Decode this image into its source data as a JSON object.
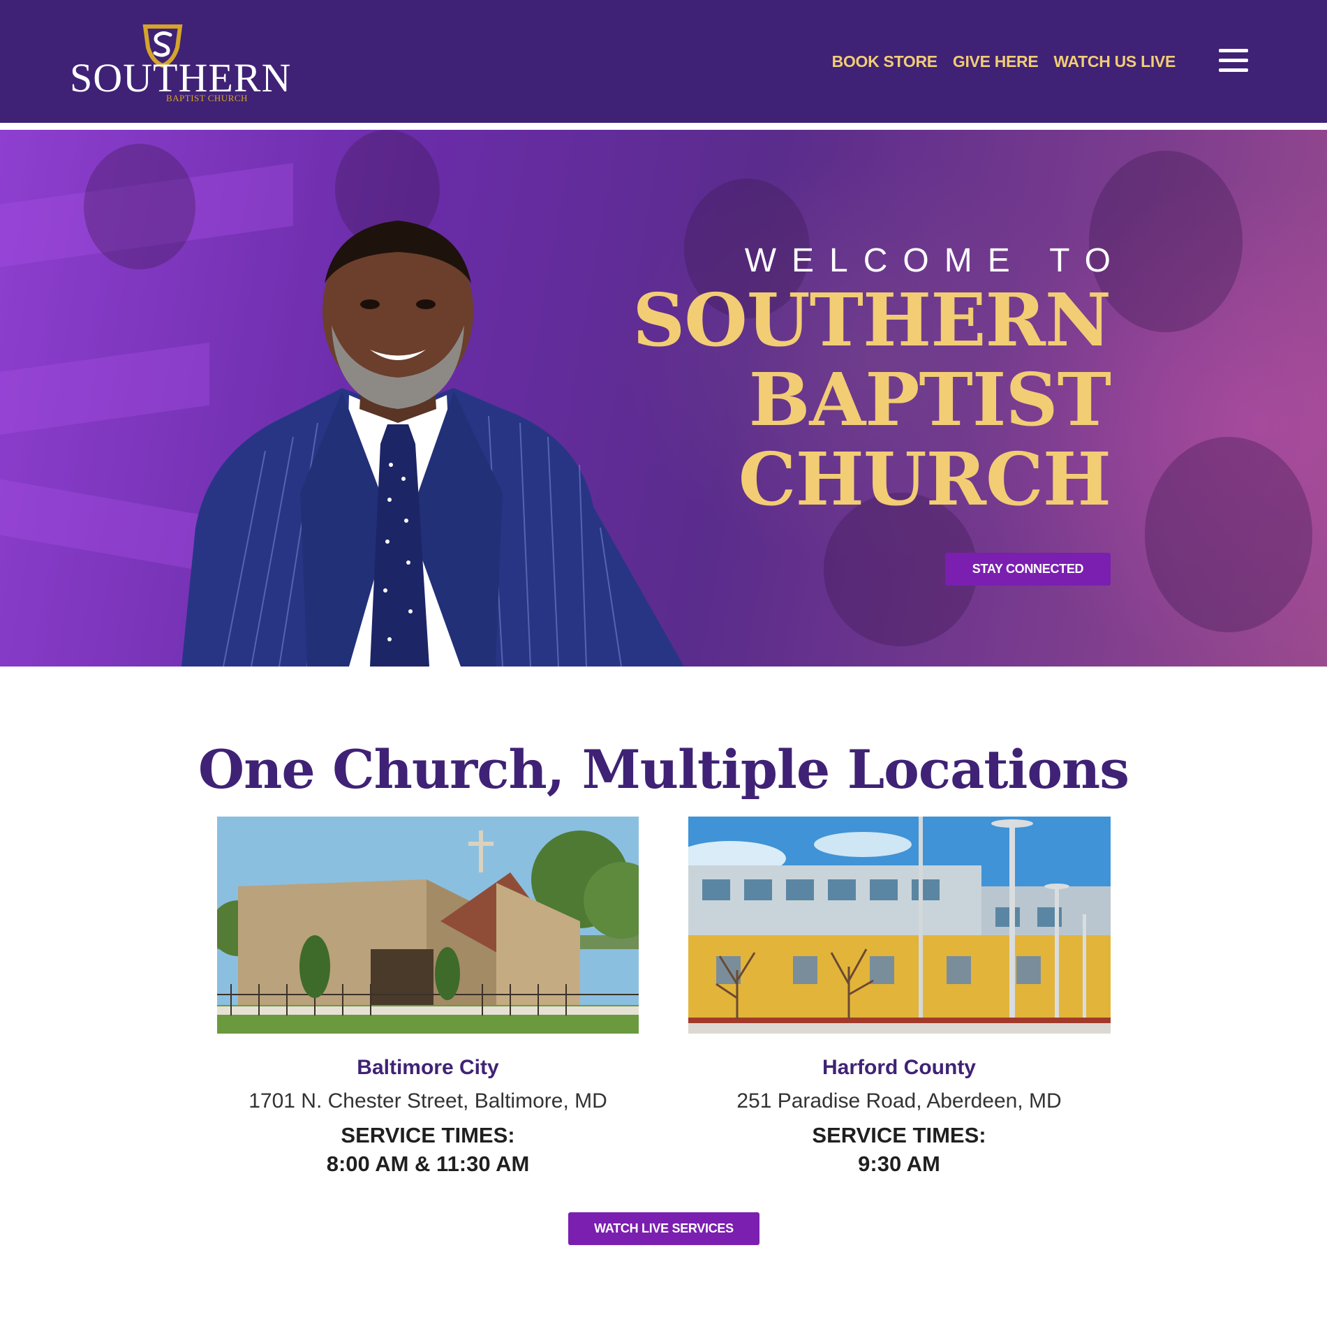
{
  "brand": {
    "logo_word": "SOUTHERN",
    "logo_subtitle": "BAPTIST CHURCH",
    "primary_color": "#3f2275",
    "accent_color": "#f2cd74",
    "button_color": "#7a1fb0"
  },
  "nav": {
    "items": [
      {
        "label": "BOOK STORE"
      },
      {
        "label": "GIVE HERE"
      },
      {
        "label": "WATCH US LIVE"
      }
    ],
    "menu_icon": "hamburger-menu-icon"
  },
  "hero": {
    "welcome": "WELCOME TO",
    "title_lines": [
      "SOUTHERN",
      "BAPTIST",
      "CHURCH"
    ],
    "button_label": "STAY CONNECTED"
  },
  "locations": {
    "heading": "One Church, Multiple Locations",
    "items": [
      {
        "name": "Baltimore City",
        "address": "1701 N. Chester Street, Baltimore, MD",
        "service_label": "SERVICE TIMES:",
        "service_times": "8:00 AM & 11:30 AM"
      },
      {
        "name": "Harford County",
        "address": "251 Paradise Road, Aberdeen, MD",
        "service_label": "SERVICE TIMES:",
        "service_times": "9:30 AM"
      }
    ],
    "button_label": "WATCH LIVE SERVICES"
  }
}
